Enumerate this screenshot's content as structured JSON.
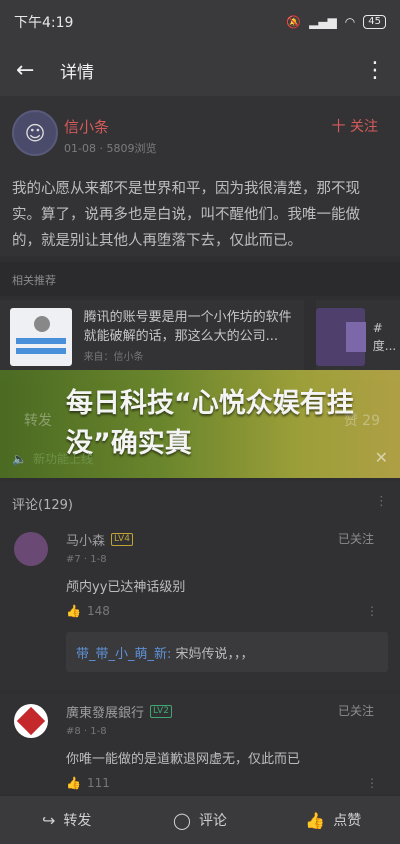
{
  "status_bar": {
    "time": "下午4:19",
    "battery": "45"
  },
  "header": {
    "title": "详情"
  },
  "post": {
    "author": "信小条",
    "date_views": "01-08 · 5809浏览",
    "follow_label": "十 关注",
    "content": "我的心愿从来都不是世界和平，因为我很清楚，那不现实。算了，说再多也是白说，叫不醒他们。我唯一能做的，就是别让其他人再堕落下去，仅此而已。"
  },
  "related": {
    "section_title": "相关推荐",
    "items": [
      {
        "text": "腾讯的账号要是用一个小作坊的软件就能破解的话，那这么大的公司...",
        "from": "来自：信小条"
      },
      {
        "text": "#度..."
      }
    ]
  },
  "overlay": {
    "headline": "每日科技“心悦众娱有挂没”确实真",
    "faint_left": "转发",
    "faint_right": "赞 29",
    "banner_text": "新功能上线",
    "banner_close": "✕"
  },
  "comments": {
    "header": "评论(129)",
    "items": [
      {
        "name": "马小森",
        "level": "LV4",
        "follow": "已关注",
        "sub": "#7 · 1-8",
        "text": "颅内yy已达神话级别",
        "likes": "148",
        "reply_name": "带_带_小_萌_新:",
        "reply_text": " 宋妈传说，，，"
      },
      {
        "name": "廣東發展銀行",
        "level": "LV2",
        "follow": "已关注",
        "sub": "#8 · 1-8",
        "text": "你唯一能做的是道歉退网虚无，仅此而已",
        "likes": "111"
      }
    ]
  },
  "bottom_bar": {
    "forward": "转发",
    "comment": "评论",
    "like": "点赞"
  }
}
